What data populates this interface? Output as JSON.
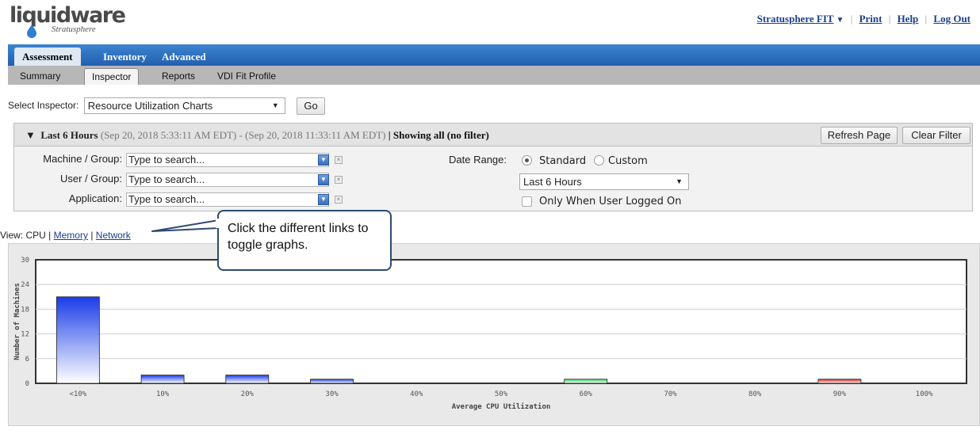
{
  "header": {
    "logo": "liquidware",
    "logo_sub": "Stratusphere",
    "links": {
      "product": "Stratusphere FIT",
      "print": "Print",
      "help": "Help",
      "logout": "Log Out"
    }
  },
  "main_tabs": [
    "Assessment",
    "Inventory",
    "Advanced"
  ],
  "sub_tabs": [
    "Summary",
    "Inspector",
    "Reports",
    "VDI Fit Profile"
  ],
  "inspector": {
    "label": "Select Inspector:",
    "selected": "Resource Utilization Charts",
    "go": "Go"
  },
  "filter": {
    "range": "Last 6 Hours",
    "dates": "(Sep 20, 2018 5:33:11 AM EDT) - (Sep 20, 2018 11:33:11 AM EDT)",
    "divider": "|",
    "showing": "Showing all (no filter)",
    "refresh": "Refresh Page",
    "clear": "Clear Filter",
    "machine_label": "Machine / Group:",
    "user_label": "User / Group:",
    "app_label": "Application:",
    "placeholder": "Type to search...",
    "date_range_label": "Date Range:",
    "standard": "Standard",
    "custom": "Custom",
    "period": "Last 6 Hours",
    "logged_on": "Only When User Logged On"
  },
  "view": {
    "prefix": "View:",
    "cpu": "CPU",
    "sep": "|",
    "memory": "Memory",
    "network": "Network"
  },
  "callout": "Click the different links to toggle graphs.",
  "chart_data": {
    "type": "bar",
    "categories": [
      "<10%",
      "10%",
      "20%",
      "30%",
      "40%",
      "50%",
      "60%",
      "70%",
      "80%",
      "90%",
      "100%"
    ],
    "values": [
      21,
      2,
      2,
      1,
      0,
      0,
      1,
      0,
      0,
      1,
      0
    ],
    "bar_colors": [
      "#1a3ce8",
      "#1a3ce8",
      "#1a3ce8",
      "#1a3ce8",
      "#1a3ce8",
      "#1a3ce8",
      "#2fd35a",
      "#2fd35a",
      "#2fd35a",
      "#e02020",
      "#e02020"
    ],
    "xlabel": "Average CPU Utilization",
    "ylabel": "Number of Machines",
    "yticks": [
      0,
      6,
      12,
      18,
      24,
      30
    ],
    "ylim": [
      0,
      30
    ],
    "grid": true
  }
}
